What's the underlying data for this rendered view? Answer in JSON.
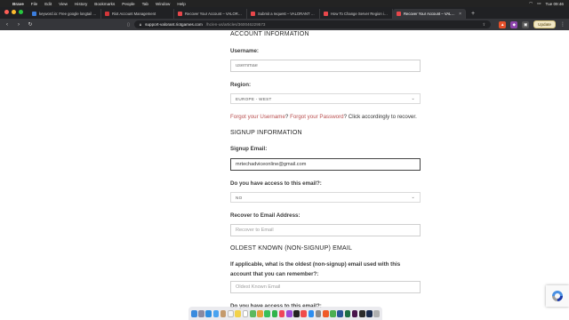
{
  "menubar": {
    "app_name": "Brave",
    "items": [
      "File",
      "Edit",
      "View",
      "History",
      "Bookmarks",
      "People",
      "Tab",
      "Window",
      "Help"
    ],
    "clock": "Tue 09:46"
  },
  "tabs": [
    {
      "label": "keyword.io: Free google longtail keyword...",
      "color": "#3b7ddd",
      "active": false
    },
    {
      "label": "Riot Account Management",
      "color": "#d13639",
      "active": false
    },
    {
      "label": "Recover Your Account – VALORANT Su...",
      "color": "#e8474b",
      "active": false
    },
    {
      "label": "Submit a request – VALORANT Support",
      "color": "#e8474b",
      "active": false
    },
    {
      "label": "How To Change Server Region in Val...",
      "color": "#e8474b",
      "active": false
    },
    {
      "label": "Recover Your Account – VALORANT",
      "color": "#e8474b",
      "active": true
    }
  ],
  "toolbar": {
    "url_host": "support-valorant.riotgames.com",
    "url_path": "/hc/en-us/articles/360046229573",
    "update_label": "Update"
  },
  "form": {
    "account_section": "ACCOUNT INFORMATION",
    "username_label": "Username:",
    "username_value": "usernmae",
    "region_label": "Region:",
    "region_value": "EUROPE - WEST",
    "forgot_username": "Forgot your Username",
    "forgot_sep1": "? ",
    "forgot_password": "Forgot your Password",
    "forgot_tail": "? Click accordingly to recover.",
    "signup_section": "SIGNUP INFORMATION",
    "signup_email_label": "Signup Email:",
    "signup_email_value": "mrtechadviceonline@gmail.com",
    "access_label": "Do you have access to this email?:",
    "access_value": "NO",
    "recover_label": "Recover to Email Address:",
    "recover_placeholder": "Recover to Email",
    "oldest_section": "OLDEST KNOWN (NON-SIGNUP) EMAIL",
    "oldest_label": "If applicable, what is the oldest (non-signup) email used with this account that you can remember?:",
    "oldest_placeholder": "Oldest Known Email",
    "access2_label": "Do you have access to this email?:"
  },
  "dock": {
    "apps": [
      {
        "name": "finder",
        "color": "#3a8bde"
      },
      {
        "name": "launchpad",
        "color": "#8a8aa0"
      },
      {
        "name": "safari",
        "color": "#2f8fe0"
      },
      {
        "name": "mail",
        "color": "#4aa3f0"
      },
      {
        "name": "contacts",
        "color": "#c49a6c"
      },
      {
        "name": "calendar",
        "color": "#f5f5f5"
      },
      {
        "name": "notes",
        "color": "#f2d24a"
      },
      {
        "name": "reminders",
        "color": "#ffffff"
      },
      {
        "name": "maps",
        "color": "#5db85d"
      },
      {
        "name": "photos",
        "color": "#e8a23a"
      },
      {
        "name": "messages",
        "color": "#37c05a"
      },
      {
        "name": "facetime",
        "color": "#2fb44a"
      },
      {
        "name": "music",
        "color": "#f0455a"
      },
      {
        "name": "podcasts",
        "color": "#9b4ad6"
      },
      {
        "name": "tv",
        "color": "#222222"
      },
      {
        "name": "news",
        "color": "#f04a4a"
      },
      {
        "name": "appstore",
        "color": "#2d8ef0"
      },
      {
        "name": "settings",
        "color": "#8a8a8a"
      },
      {
        "name": "brave",
        "color": "#f05a28"
      },
      {
        "name": "chrome",
        "color": "#4caf50"
      },
      {
        "name": "word",
        "color": "#2b5797"
      },
      {
        "name": "excel",
        "color": "#1e7145"
      },
      {
        "name": "slack",
        "color": "#4a154b"
      },
      {
        "name": "terminal",
        "color": "#2b2b2b"
      },
      {
        "name": "photoshop",
        "color": "#1a2b4d"
      },
      {
        "name": "trash",
        "color": "#b0b0b0"
      }
    ]
  }
}
